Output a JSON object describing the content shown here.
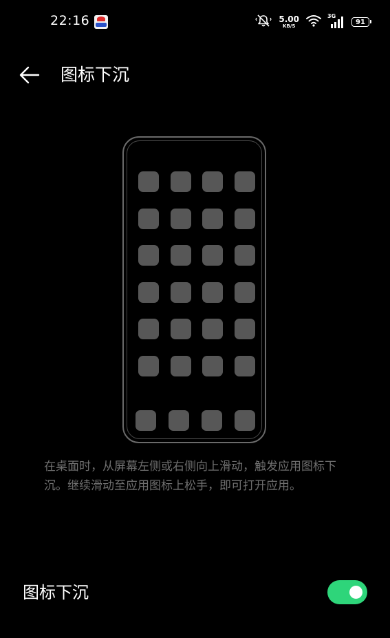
{
  "status_bar": {
    "time": "22:16",
    "speed_value": "5.00",
    "speed_unit": "KB/S",
    "network_type": "3G",
    "battery_level": "91"
  },
  "header": {
    "back_icon": "arrow-left-icon",
    "title": "图标下沉"
  },
  "illustration": {
    "grid_icon_count": 24,
    "dock_icon_count": 4
  },
  "description": "在桌面时，从屏幕左侧或右侧向上滑动，触发应用图标下沉。继续滑动至应用图标上松手，即可打开应用。",
  "setting": {
    "label": "图标下沉",
    "enabled": true
  },
  "colors": {
    "background": "#000000",
    "toggle_on": "#2ed57a",
    "description_text": "#6f6f6f",
    "app_icon": "#575757"
  }
}
